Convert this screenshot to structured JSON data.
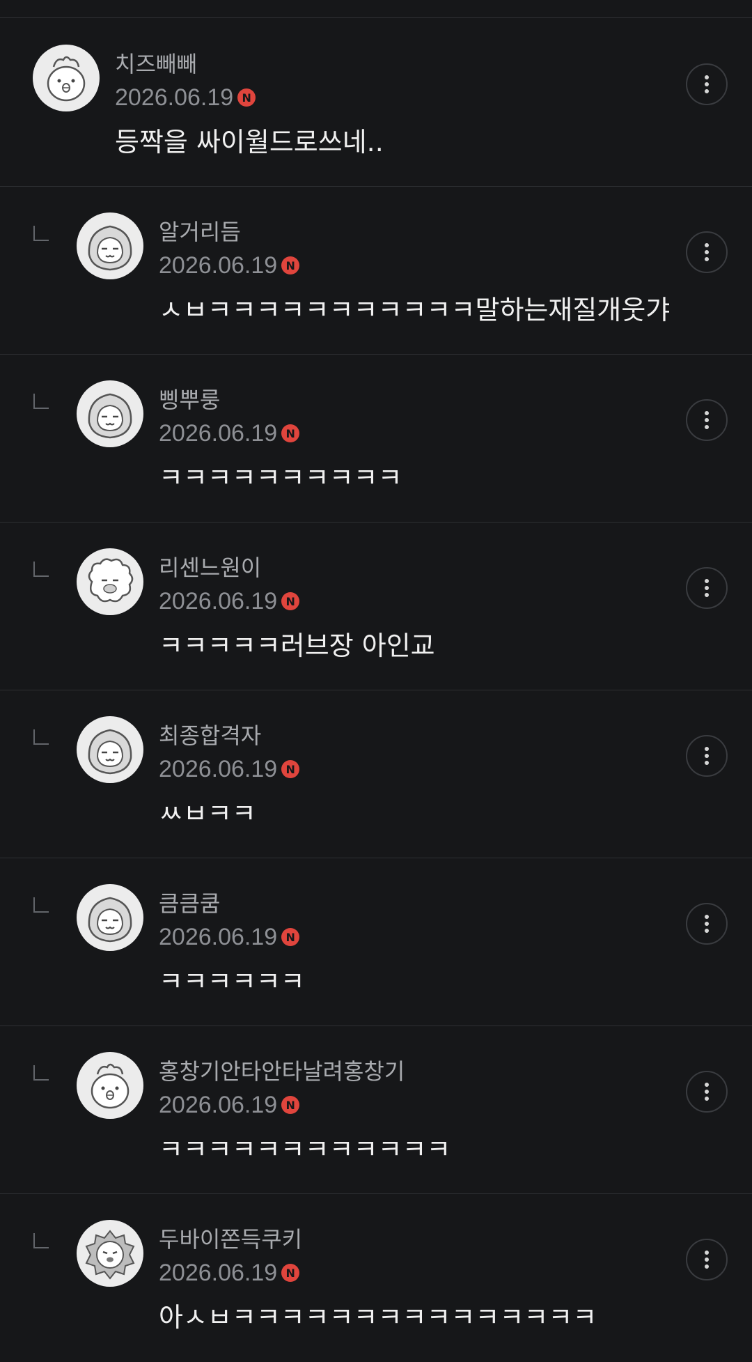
{
  "comments": [
    {
      "nickname": "치즈빼빼",
      "date": "2026.06.19",
      "badge": "N",
      "text": "등짝을 싸이월드로쓰네..",
      "is_reply": false,
      "avatar": "chick-avatar-icon"
    },
    {
      "nickname": "알거리듬",
      "date": "2026.06.19",
      "badge": "N",
      "text": "ㅅㅂㅋㅋㅋㅋㅋㅋㅋㅋㅋㅋㅋ말하는재질개웃갸",
      "is_reply": true,
      "avatar": "hooded-cat-avatar-icon"
    },
    {
      "nickname": "삥뿌룽",
      "date": "2026.06.19",
      "badge": "N",
      "text": "ㅋㅋㅋㅋㅋㅋㅋㅋㅋㅋ",
      "is_reply": true,
      "avatar": "hooded-cat-avatar-icon"
    },
    {
      "nickname": "리센느원이",
      "date": "2026.06.19",
      "badge": "N",
      "text": "ㅋㅋㅋㅋㅋ러브장 아인교",
      "is_reply": true,
      "avatar": "sheep-avatar-icon"
    },
    {
      "nickname": "최종합격자",
      "date": "2026.06.19",
      "badge": "N",
      "text": "ㅆㅂㅋㅋ",
      "is_reply": true,
      "avatar": "hooded-cat-avatar-icon"
    },
    {
      "nickname": "큼큼쿰",
      "date": "2026.06.19",
      "badge": "N",
      "text": "ㅋㅋㅋㅋㅋㅋ",
      "is_reply": true,
      "avatar": "hooded-cat-avatar-icon"
    },
    {
      "nickname": "홍창기안타안타날려홍창기",
      "date": "2026.06.19",
      "badge": "N",
      "text": "ㅋㅋㅋㅋㅋㅋㅋㅋㅋㅋㅋㅋ",
      "is_reply": true,
      "avatar": "chick-avatar-icon"
    },
    {
      "nickname": "두바이쫀득쿠키",
      "date": "2026.06.19",
      "badge": "N",
      "text": "아ㅅㅂㅋㅋㅋㅋㅋㅋㅋㅋㅋㅋㅋㅋㅋㅋㅋ",
      "is_reply": true,
      "avatar": "lion-avatar-icon"
    }
  ],
  "colors": {
    "background": "#161719",
    "divider": "#2e3033",
    "nickname": "#a9abaf",
    "date": "#8e9095",
    "new_badge": "#e0453d",
    "text": "#f0f0f0"
  }
}
